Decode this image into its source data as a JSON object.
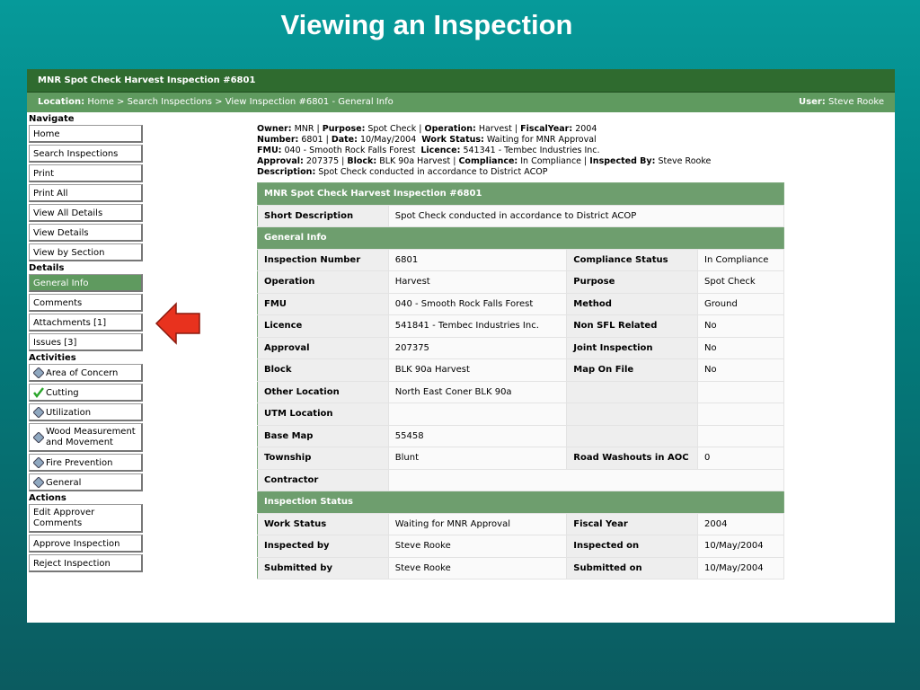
{
  "slide_title": "Viewing an Inspection",
  "app": {
    "title": "MNR Spot Check Harvest Inspection #6801",
    "location_label": "Location:",
    "location_path": "Home > Search Inspections > View Inspection #6801 - General Info",
    "user_label": "User:",
    "user_name": "Steve Rooke"
  },
  "sidebar": {
    "navigate_label": "Navigate",
    "navigate": [
      "Home",
      "Search Inspections",
      "Print",
      "Print All",
      "View All Details",
      "View Details",
      "View by Section"
    ],
    "details_label": "Details",
    "details": [
      "General Info",
      "Comments",
      "Attachments [1]",
      "Issues [3]"
    ],
    "activities_label": "Activities",
    "activities": [
      "Area of Concern",
      "Cutting",
      "Utilization",
      "Wood Measurement and Movement",
      "Fire Prevention",
      "General"
    ],
    "actions_label": "Actions",
    "actions": [
      "Edit Approver Comments",
      "Approve Inspection",
      "Reject Inspection"
    ]
  },
  "summary": {
    "owner_label": "Owner:",
    "owner": "MNR",
    "purpose_label": "Purpose:",
    "purpose": "Spot Check",
    "operation_label": "Operation:",
    "operation": "Harvest",
    "fiscal_label": "FiscalYear:",
    "fiscal": "2004",
    "number_label": "Number:",
    "number": "6801",
    "date_label": "Date:",
    "date": "10/May/2004",
    "work_label": "Work Status:",
    "work": "Waiting for MNR Approval",
    "fmu_label": "FMU:",
    "fmu": "040 - Smooth Rock Falls Forest",
    "licence_label": "Licence:",
    "licence": "541341 - Tembec Industries Inc.",
    "approval_label": "Approval:",
    "approval": "207375",
    "block_label": "Block:",
    "block": "BLK 90a Harvest",
    "compliance_label": "Compliance:",
    "compliance": "In Compliance",
    "inspected_label": "Inspected By:",
    "inspected": "Steve Rooke",
    "desc_label": "Description:",
    "desc": "Spot Check conducted in accordance to District ACOP"
  },
  "detail": {
    "title": "MNR Spot Check Harvest Inspection #6801",
    "short_desc_label": "Short Description",
    "short_desc": "Spot Check conducted in accordance to District ACOP",
    "general_info_header": "General Info",
    "rows": [
      [
        "Inspection Number",
        "6801",
        "Compliance Status",
        "In Compliance"
      ],
      [
        "Operation",
        "Harvest",
        "Purpose",
        "Spot Check"
      ],
      [
        "FMU",
        "040 - Smooth Rock Falls Forest",
        "Method",
        "Ground"
      ],
      [
        "Licence",
        "541841 - Tembec Industries Inc.",
        "Non SFL Related",
        "No"
      ],
      [
        "Approval",
        "207375",
        "Joint Inspection",
        "No"
      ],
      [
        "Block",
        "BLK 90a Harvest",
        "Map On File",
        "No"
      ],
      [
        "Other Location",
        "North East Coner BLK 90a",
        "",
        ""
      ],
      [
        "UTM Location",
        "",
        "",
        ""
      ],
      [
        "Base Map",
        "55458",
        "",
        ""
      ],
      [
        "Township",
        "Blunt",
        "Road Washouts in AOC",
        "0"
      ]
    ],
    "contractor_label": "Contractor",
    "status_header": "Inspection Status",
    "status_rows": [
      [
        "Work Status",
        "Waiting for MNR Approval",
        "Fiscal Year",
        "2004"
      ],
      [
        "Inspected by",
        "Steve Rooke",
        "Inspected on",
        "10/May/2004"
      ],
      [
        "Submitted by",
        "Steve Rooke",
        "Submitted on",
        "10/May/2004"
      ]
    ]
  },
  "colors": {
    "accent_green": "#5f9a5f",
    "dark_green": "#2f6b2f",
    "arrow_red": "#e8321e",
    "check_green": "#2aa52a"
  }
}
